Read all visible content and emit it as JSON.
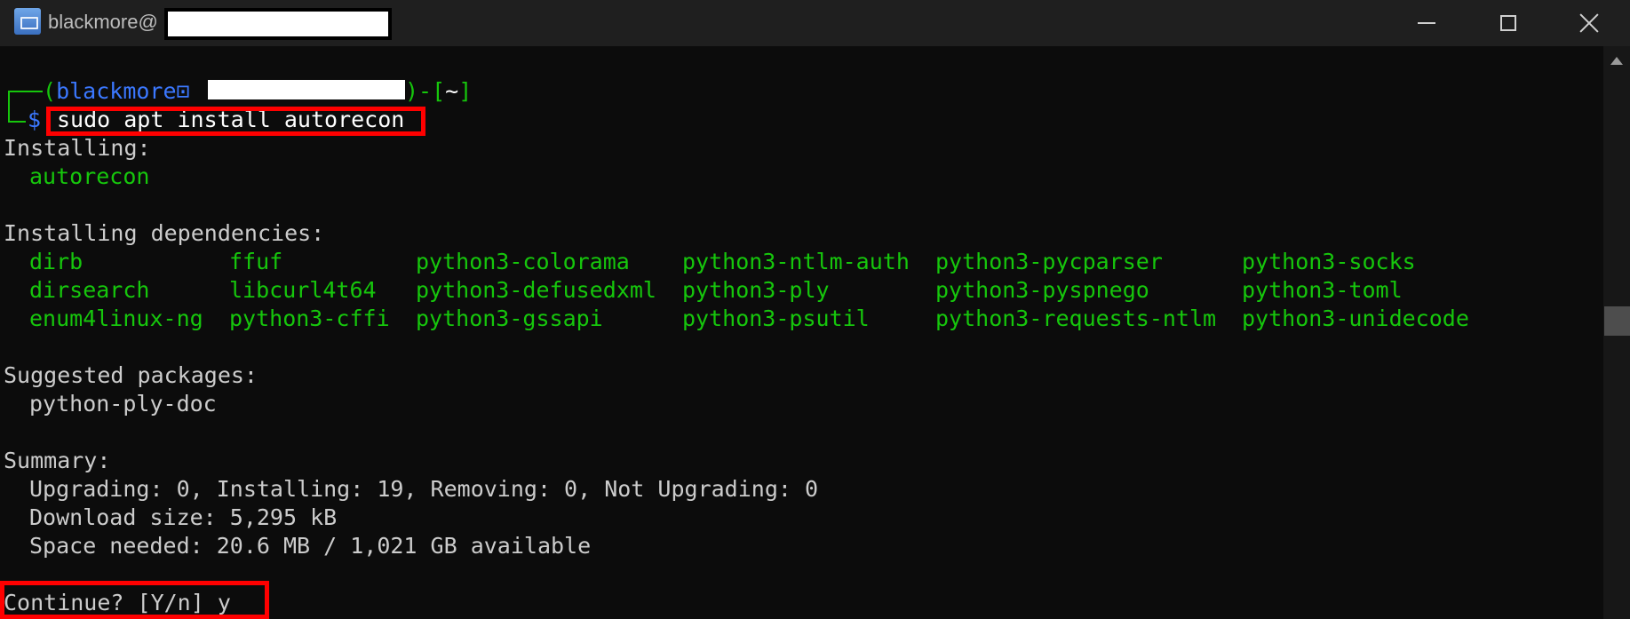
{
  "window": {
    "title": "blackmore@",
    "controls": {
      "minimize": "minimize",
      "maximize": "maximize",
      "close": "close"
    }
  },
  "prompt": {
    "open_paren": "(",
    "user": "blackmore",
    "glyph": "⊡",
    "close_part": ")-[",
    "cwd": "~",
    "close_bracket": "]",
    "dollar": "$",
    "command": "sudo apt install autorecon"
  },
  "output": {
    "installing_header": "Installing:",
    "installing_items": [
      "autorecon"
    ],
    "dependencies_header": "Installing dependencies:",
    "dependencies_columns": [
      [
        "dirb",
        "dirsearch",
        "enum4linux-ng"
      ],
      [
        "ffuf",
        "libcurl4t64",
        "python3-cffi"
      ],
      [
        "python3-colorama",
        "python3-defusedxml",
        "python3-gssapi"
      ],
      [
        "python3-ntlm-auth",
        "python3-ply",
        "python3-psutil"
      ],
      [
        "python3-pycparser",
        "python3-pyspnego",
        "python3-requests-ntlm"
      ],
      [
        "python3-socks",
        "python3-toml",
        "python3-unidecode"
      ]
    ],
    "suggested_header": "Suggested packages:",
    "suggested_items": [
      "python-ply-doc"
    ],
    "summary_header": "Summary:",
    "summary_lines": [
      "Upgrading: 0, Installing: 19, Removing: 0, Not Upgrading: 0",
      "Download size: 5,295 kB",
      "Space needed: 20.6 MB / 1,021 GB available"
    ],
    "continue_prompt": "Continue? [Y/n] y"
  },
  "colors": {
    "background": "#0c0c0c",
    "green": "#16c60c",
    "blue": "#3b78ff",
    "highlight_red": "#ff0000"
  }
}
